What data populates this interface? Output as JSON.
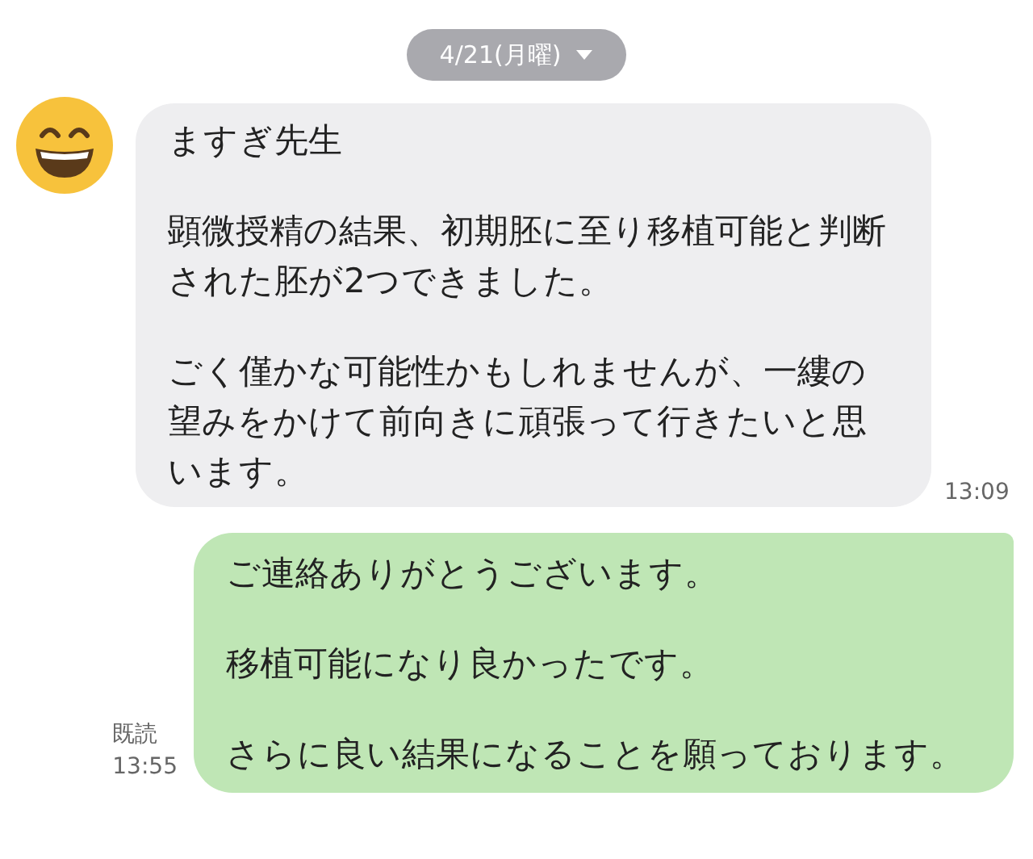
{
  "date_pill": {
    "label": "4/21(月曜)"
  },
  "messages": [
    {
      "kind": "received",
      "paragraphs": [
        "ますぎ先生",
        "顕微授精の結果、初期胚に至り移植可能と判断された胚が2つできました。",
        "ごく僅かな可能性かもしれませんが、一縷の望みをかけて前向きに頑張って行きたいと思います。"
      ],
      "time": "13:09"
    },
    {
      "kind": "sent",
      "paragraphs": [
        "ご連絡ありがとうございます。",
        "移植可能になり良かったです。",
        "さらに良い結果になることを願っております。"
      ],
      "read": "既読",
      "time": "13:55"
    }
  ]
}
